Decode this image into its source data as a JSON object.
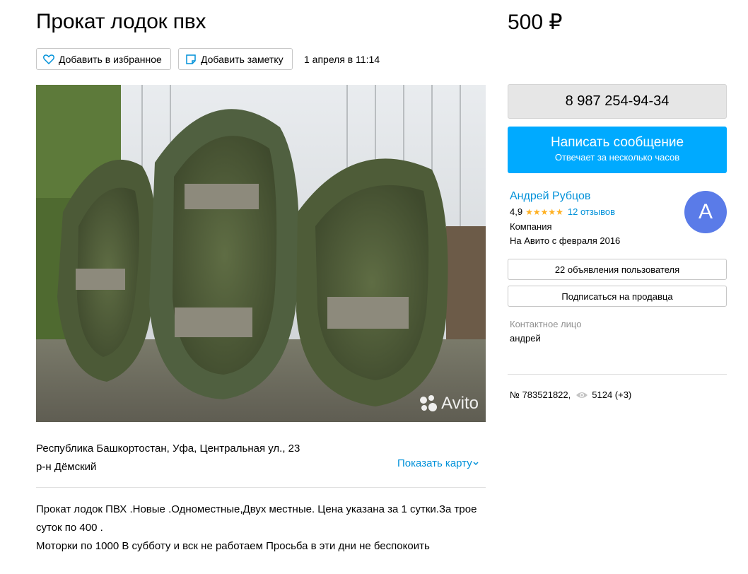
{
  "listing": {
    "title": "Прокат лодок пвх",
    "price": "500 ₽",
    "favorite_label": "Добавить в избранное",
    "note_label": "Добавить заметку",
    "date": "1 апреля в 11:14",
    "watermark": "Avito"
  },
  "location": {
    "address": "Республика Башкортостан, Уфа, Центральная ул., 23",
    "district": "р-н Дёмский",
    "show_map": "Показать карту"
  },
  "description": {
    "line1": "Прокат лодок ПВХ .Новые .Одноместные,Двух местные. Цена указана за 1 сутки.За трое суток по 400 .",
    "line2": "Моторки по 1000 В субботу и вск не работаем Просьба в эти дни не беспокоить"
  },
  "contact": {
    "phone": "8 987 254-94-34",
    "message_title": "Написать сообщение",
    "message_sub": "Отвечает за несколько часов"
  },
  "seller": {
    "name": "Андрей Рубцов",
    "rating": "4,9",
    "stars": "★★★★★",
    "reviews": "12 отзывов",
    "type": "Компания",
    "since": "На Авито с февраля 2016",
    "avatar_letter": "А",
    "ads_button": "22 объявления пользователя",
    "subscribe_button": "Подписаться на продавца",
    "contact_label": "Контактное лицо",
    "contact_name": "андрей"
  },
  "meta": {
    "item_number": "№ 783521822,",
    "views": "5124 (+3)"
  },
  "colors": {
    "accent": "#00aaff",
    "link": "#0091d9",
    "avatar": "#5a7be8",
    "stars": "#ffb021"
  }
}
